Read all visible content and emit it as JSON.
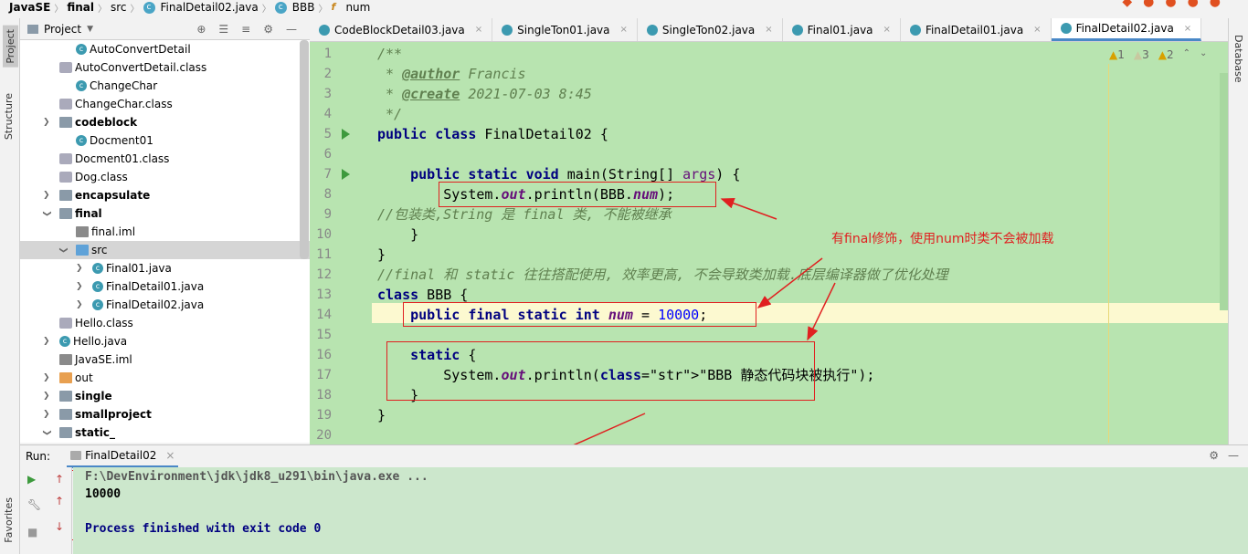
{
  "breadcrumb": {
    "items": [
      "JavaSE",
      "final",
      "src",
      "FinalDetail02.java",
      "BBB",
      "num"
    ]
  },
  "left_toolwindows": {
    "project": "Project",
    "structure": "Structure",
    "favorites": "Favorites"
  },
  "right_toolwindows": {
    "database": "Database"
  },
  "project_panel": {
    "title": "Project",
    "tree": [
      {
        "label": "AutoConvertDetail",
        "icon": "java-class-icon",
        "bold": false,
        "indent": 2,
        "arrow": ""
      },
      {
        "label": "AutoConvertDetail.class",
        "icon": "class-file-icon",
        "bold": false,
        "indent": 1,
        "arrow": ""
      },
      {
        "label": "ChangeChar",
        "icon": "java-class-icon",
        "bold": false,
        "indent": 2,
        "arrow": ""
      },
      {
        "label": "ChangeChar.class",
        "icon": "class-file-icon",
        "bold": false,
        "indent": 1,
        "arrow": ""
      },
      {
        "label": "codeblock",
        "icon": "folder-icon",
        "bold": true,
        "indent": 1,
        "arrow": "›"
      },
      {
        "label": "Docment01",
        "icon": "java-class-icon",
        "bold": false,
        "indent": 2,
        "arrow": ""
      },
      {
        "label": "Docment01.class",
        "icon": "class-file-icon",
        "bold": false,
        "indent": 1,
        "arrow": ""
      },
      {
        "label": "Dog.class",
        "icon": "class-file-icon",
        "bold": false,
        "indent": 1,
        "arrow": ""
      },
      {
        "label": "encapsulate",
        "icon": "folder-icon",
        "bold": true,
        "indent": 1,
        "arrow": "›"
      },
      {
        "label": "final",
        "icon": "folder-icon",
        "bold": true,
        "indent": 1,
        "arrow": "⌄"
      },
      {
        "label": "final.iml",
        "icon": "iml-file-icon",
        "bold": false,
        "indent": 2,
        "arrow": ""
      },
      {
        "label": "src",
        "icon": "source-folder-icon",
        "bold": false,
        "indent": 2,
        "arrow": "⌄",
        "selected": true
      },
      {
        "label": "Final01.java",
        "icon": "java-class-icon",
        "bold": false,
        "indent": 3,
        "arrow": "›"
      },
      {
        "label": "FinalDetail01.java",
        "icon": "java-class-icon",
        "bold": false,
        "indent": 3,
        "arrow": "›"
      },
      {
        "label": "FinalDetail02.java",
        "icon": "java-class-icon",
        "bold": false,
        "indent": 3,
        "arrow": "›"
      },
      {
        "label": "Hello.class",
        "icon": "class-file-icon",
        "bold": false,
        "indent": 1,
        "arrow": ""
      },
      {
        "label": "Hello.java",
        "icon": "java-class-icon",
        "bold": false,
        "indent": 1,
        "arrow": "›"
      },
      {
        "label": "JavaSE.iml",
        "icon": "iml-file-icon",
        "bold": false,
        "indent": 1,
        "arrow": ""
      },
      {
        "label": "out",
        "icon": "excluded-folder-icon",
        "bold": false,
        "indent": 1,
        "arrow": "›"
      },
      {
        "label": "single",
        "icon": "folder-icon",
        "bold": true,
        "indent": 1,
        "arrow": "›"
      },
      {
        "label": "smallproject",
        "icon": "folder-icon",
        "bold": true,
        "indent": 1,
        "arrow": "›"
      },
      {
        "label": "static_",
        "icon": "folder-icon",
        "bold": true,
        "indent": 1,
        "arrow": "⌄"
      }
    ]
  },
  "editor_tabs": [
    {
      "label": "CodeBlockDetail03.java",
      "active": false
    },
    {
      "label": "SingleTon01.java",
      "active": false
    },
    {
      "label": "SingleTon02.java",
      "active": false
    },
    {
      "label": "Final01.java",
      "active": false
    },
    {
      "label": "FinalDetail01.java",
      "active": false
    },
    {
      "label": "FinalDetail02.java",
      "active": true
    }
  ],
  "inspections": {
    "warnings": "1",
    "weak_warnings": "3",
    "typos": "2"
  },
  "code_lines": [
    "/**",
    " * @author Francis",
    " * @create 2021-07-03 8:45",
    " */",
    "public class FinalDetail02 {",
    "",
    "    public static void main(String[] args) {",
    "        System.out.println(BBB.num);",
    "//包装类,String 是 final 类, 不能被继承",
    "    }",
    "}",
    "//final 和 static 往往搭配使用, 效率更高, 不会导致类加载.底层编译器做了优化处理",
    "class BBB {",
    "    public final static int num = 10000;",
    "",
    "    static {",
    "        System.out.println(\"BBB 静态代码块被执行\");",
    "    }",
    "}",
    ""
  ],
  "annotation": "有final修饰，使用num时类不会被加载",
  "run_panel": {
    "label": "Run:",
    "tab": "FinalDetail02",
    "console": [
      "F:\\DevEnvironment\\jdk\\jdk8_u291\\bin\\java.exe ...",
      "10000",
      "",
      "Process finished with exit code 0"
    ]
  },
  "colors": {
    "editor_bg": "#b8e4b0",
    "keyword": "#000080",
    "comment": "#608050",
    "annotation": "#e02020",
    "console_bg": "#cce7cc"
  }
}
